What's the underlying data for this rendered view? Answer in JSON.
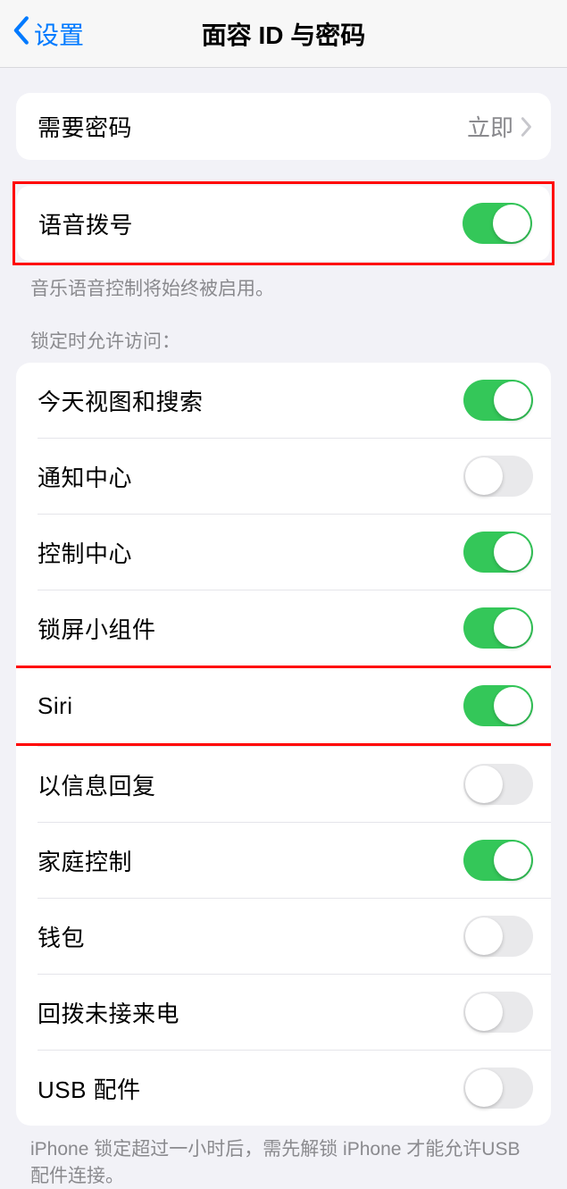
{
  "nav": {
    "back_label": "设置",
    "title": "面容 ID 与密码"
  },
  "require_passcode": {
    "label": "需要密码",
    "value": "立即"
  },
  "voice_dial": {
    "label": "语音拨号",
    "enabled": true,
    "footer": "音乐语音控制将始终被启用。"
  },
  "locked_access": {
    "header": "锁定时允许访问：",
    "items": [
      {
        "label": "今天视图和搜索",
        "enabled": true
      },
      {
        "label": "通知中心",
        "enabled": false
      },
      {
        "label": "控制中心",
        "enabled": true
      },
      {
        "label": "锁屏小组件",
        "enabled": true
      },
      {
        "label": "Siri",
        "enabled": true
      },
      {
        "label": "以信息回复",
        "enabled": false
      },
      {
        "label": "家庭控制",
        "enabled": true
      },
      {
        "label": "钱包",
        "enabled": false
      },
      {
        "label": "回拨未接来电",
        "enabled": false
      },
      {
        "label": "USB 配件",
        "enabled": false
      }
    ],
    "footer": "iPhone 锁定超过一小时后，需先解锁 iPhone 才能允许USB 配件连接。"
  }
}
